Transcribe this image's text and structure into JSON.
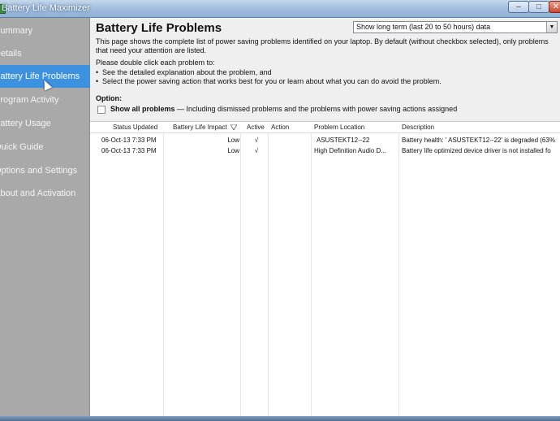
{
  "window": {
    "title": "Battery Life Maximizer",
    "min_label": "–",
    "max_label": "□",
    "close_label": "✕"
  },
  "sidebar": {
    "items": [
      {
        "label": "Summary"
      },
      {
        "label": "Details"
      },
      {
        "label": "Battery Life Problems"
      },
      {
        "label": "Program Activity"
      },
      {
        "label": "Battery Usage"
      },
      {
        "label": "Quick Guide"
      },
      {
        "label": "Options and Settings"
      },
      {
        "label": "About and Activation"
      }
    ],
    "active_index": 2
  },
  "main": {
    "title": "Battery Life Problems",
    "range_select": {
      "value": "Show long term (last 20 to 50 hours) data",
      "arrow": "▼"
    },
    "intro": "This page shows the complete list of power saving problems identified on your laptop. By default (without checkbox selected), only problems that need your attention are listed.",
    "instructions": {
      "lead": "Please double click each problem to:",
      "bullets": [
        "See the detailed explanation about the problem, and",
        "Select the power saving action that works best for you or learn about what you can do avoid the problem."
      ]
    },
    "option_label": "Option:",
    "show_all": {
      "label": "Show all problems",
      "detail": " — Including dismissed problems and the problems with power saving actions assigned",
      "checked": false
    }
  },
  "table": {
    "columns": [
      "Status Updated",
      "Battery Life Impact",
      "Active",
      "Action",
      "Problem Location",
      "Description"
    ],
    "rows": [
      {
        "status_updated": "06-Oct-13 7:33 PM",
        "impact": "Low",
        "active": "√",
        "action": "",
        "location": "ASUSTEKT12--22",
        "description": "Battery health: ' ASUSTEKT12--22' is degraded (63%"
      },
      {
        "status_updated": "06-Oct-13 7:33 PM",
        "impact": "Low",
        "active": "√",
        "action": "",
        "location": "High Definition Audio D...",
        "description": "Battery life optimized device driver is not installed fo"
      }
    ]
  }
}
